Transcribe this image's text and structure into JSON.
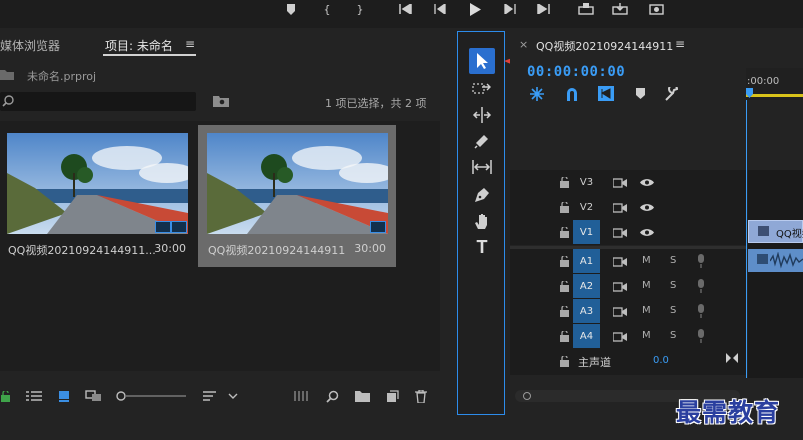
{
  "project_panel": {
    "tabs": [
      {
        "label": "媒体浏览器",
        "active": false
      },
      {
        "label": "项目: 未命名",
        "active": true
      }
    ],
    "menu_icon": "hamburger-icon",
    "project_file": "未命名.prproj",
    "selection_status": "1 项已选择，共 2 项",
    "clips": [
      {
        "name": "QQ视频20210924144911...",
        "duration": "30:00",
        "selected": false,
        "badge": "video-audio-badge"
      },
      {
        "name": "QQ视频20210924144911",
        "duration": "30:00",
        "selected": true,
        "badge": "av-clip-badge"
      }
    ]
  },
  "tools": [
    {
      "name": "selection-tool",
      "icon": "arrow-icon",
      "active": true
    },
    {
      "name": "track-select-tool",
      "icon": "track-select-icon"
    },
    {
      "name": "ripple-edit-tool",
      "icon": "ripple-edit-icon"
    },
    {
      "name": "razor-tool",
      "icon": "razor-icon"
    },
    {
      "name": "slip-tool",
      "icon": "slip-icon"
    },
    {
      "name": "pen-tool",
      "icon": "pen-icon"
    },
    {
      "name": "hand-tool",
      "icon": "hand-icon"
    },
    {
      "name": "type-tool",
      "icon": "type-icon",
      "glyph": "T"
    }
  ],
  "timeline": {
    "close": "×",
    "sequence_name": "QQ视频20210924144911",
    "menu": "≡",
    "timecode": "00:00:00:00",
    "ruler_label": ":00:00",
    "clip_label": "QQ视频",
    "tracks": [
      {
        "name": "V3",
        "kind": "video",
        "active": false
      },
      {
        "name": "V2",
        "kind": "video",
        "active": false
      },
      {
        "name": "V1",
        "kind": "video",
        "active": true
      },
      {
        "name": "A1",
        "kind": "audio",
        "active": true
      },
      {
        "name": "A2",
        "kind": "audio",
        "active": true
      },
      {
        "name": "A3",
        "kind": "audio",
        "active": true
      },
      {
        "name": "A4",
        "kind": "audio",
        "active": true
      }
    ],
    "mute_label": "M",
    "solo_label": "S",
    "master_label": "主声道",
    "master_value": "0.0"
  },
  "watermark": "最需教育",
  "colors": {
    "accent": "#2d8ceb",
    "arrow": "#e0403a",
    "timecode": "#3a9cf5"
  }
}
